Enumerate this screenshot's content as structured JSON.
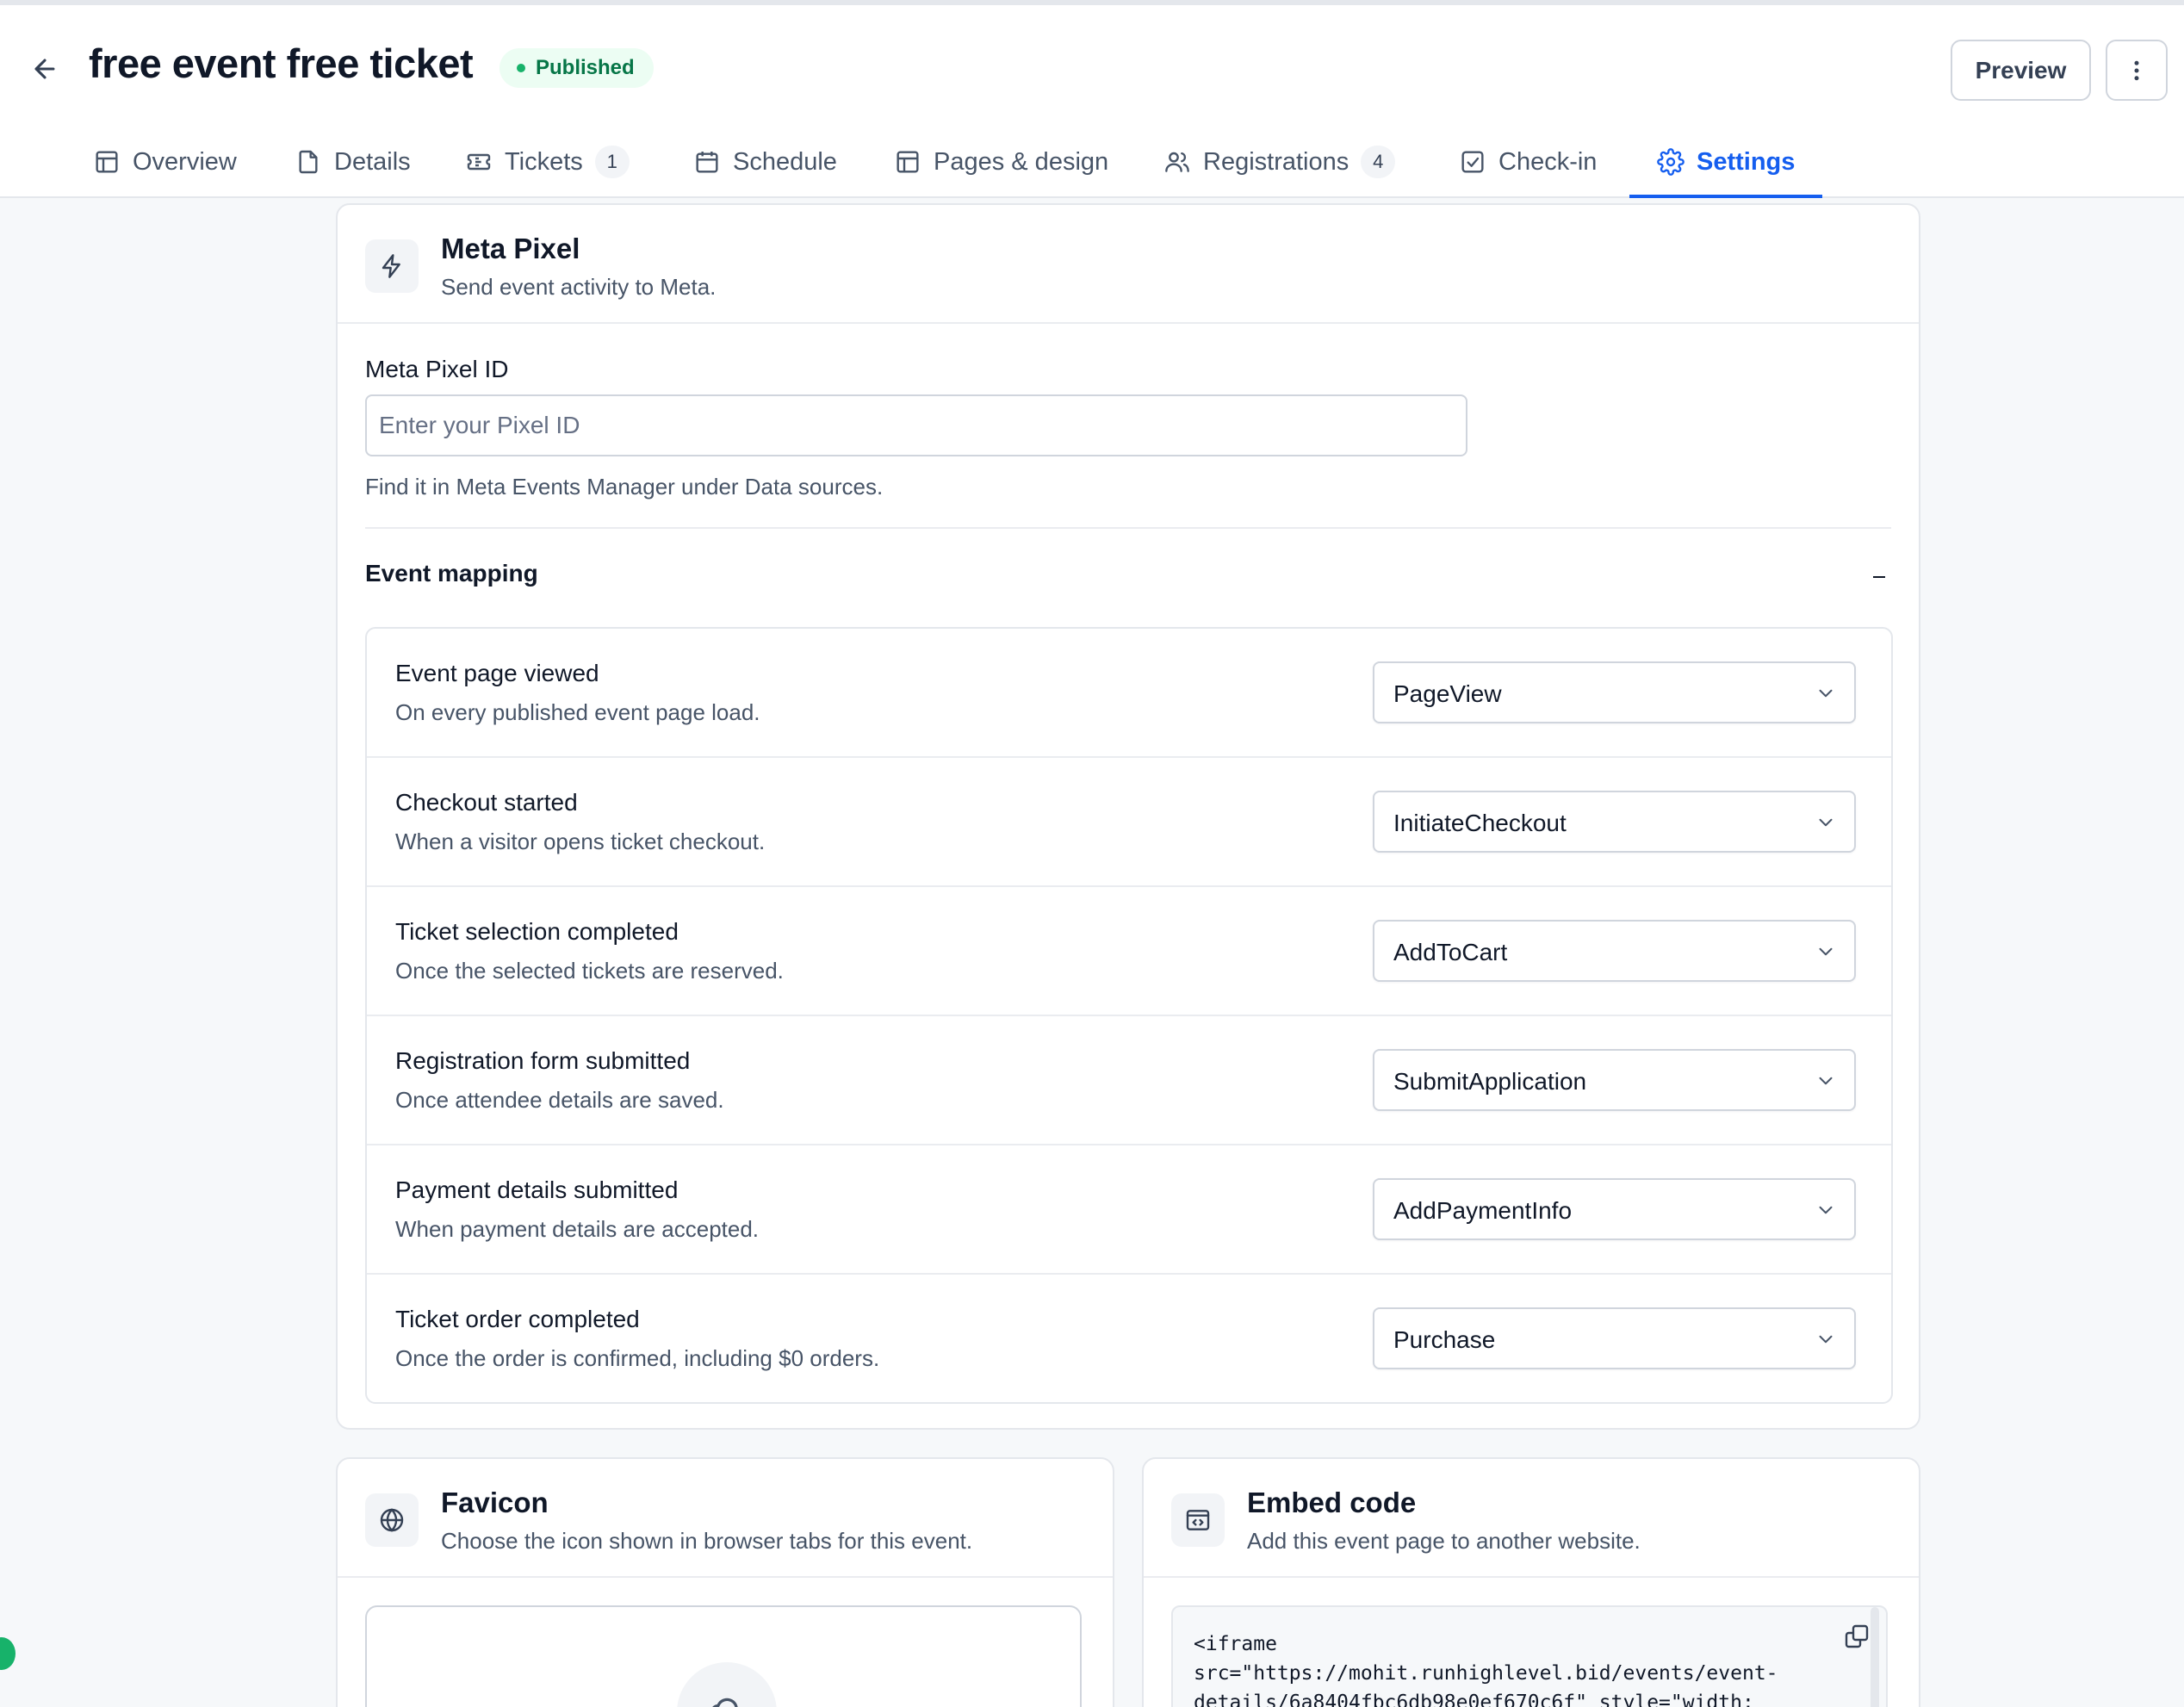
{
  "header": {
    "title": "free event free ticket",
    "status": "Published",
    "preview_label": "Preview"
  },
  "tabs": [
    {
      "label": "Overview",
      "icon": "layout-icon"
    },
    {
      "label": "Details",
      "icon": "file-icon"
    },
    {
      "label": "Tickets",
      "icon": "ticket-icon",
      "count": "1"
    },
    {
      "label": "Schedule",
      "icon": "calendar-icon"
    },
    {
      "label": "Pages & design",
      "icon": "layout-icon"
    },
    {
      "label": "Registrations",
      "icon": "users-icon",
      "count": "4"
    },
    {
      "label": "Check-in",
      "icon": "check-square-icon"
    },
    {
      "label": "Settings",
      "icon": "gear-icon",
      "active": true
    }
  ],
  "meta_pixel": {
    "title": "Meta Pixel",
    "subtitle": "Send event activity to Meta.",
    "field_label": "Meta Pixel ID",
    "placeholder": "Enter your Pixel ID",
    "value": "",
    "helper": "Find it in Meta Events Manager under Data sources.",
    "mapping_title": "Event mapping",
    "mappings": [
      {
        "title": "Event page viewed",
        "description": "On every published event page load.",
        "value": "PageView"
      },
      {
        "title": "Checkout started",
        "description": "When a visitor opens ticket checkout.",
        "value": "InitiateCheckout"
      },
      {
        "title": "Ticket selection completed",
        "description": "Once the selected tickets are reserved.",
        "value": "AddToCart"
      },
      {
        "title": "Registration form submitted",
        "description": "Once attendee details are saved.",
        "value": "SubmitApplication"
      },
      {
        "title": "Payment details submitted",
        "description": "When payment details are accepted.",
        "value": "AddPaymentInfo"
      },
      {
        "title": "Ticket order completed",
        "description": "Once the order is confirmed, including $0 orders.",
        "value": "Purchase"
      }
    ]
  },
  "favicon": {
    "title": "Favicon",
    "subtitle": "Choose the icon shown in browser tabs for this event."
  },
  "embed": {
    "title": "Embed code",
    "subtitle": "Add this event page to another website.",
    "code": "<iframe\nsrc=\"https://mohit.runhighlevel.bid/events/event-\ndetails/6a8404fbc6db98e0ef670c6f\" style=\"width:"
  },
  "colors": {
    "accent": "#155eef",
    "success": "#17b26a",
    "success_text": "#067647"
  }
}
